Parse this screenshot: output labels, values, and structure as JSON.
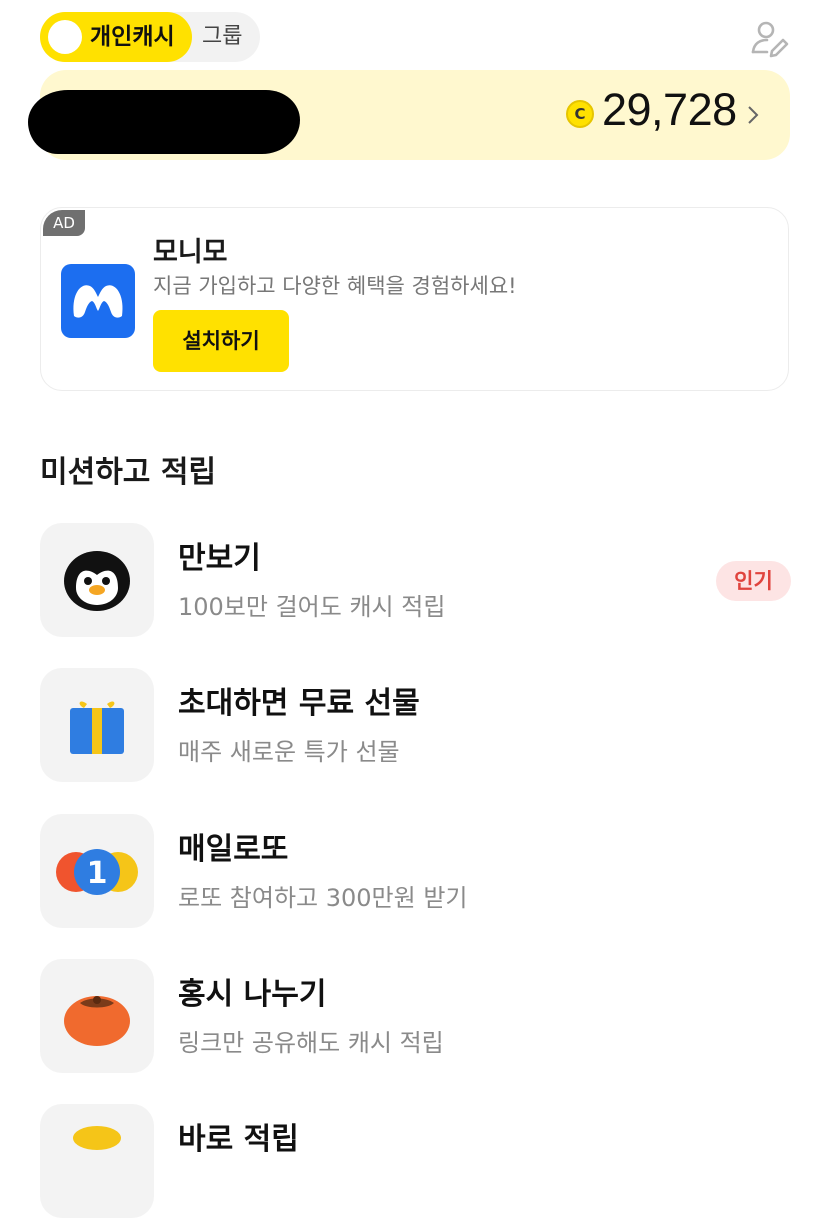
{
  "header": {
    "tab_personal": "개인캐시",
    "tab_group": "그룹"
  },
  "balance": {
    "coin_symbol": "C",
    "amount": "29,728"
  },
  "ad": {
    "badge": "AD",
    "title": "모니모",
    "description": "지금 가입하고 다양한 혜택을 경험하세요!",
    "button": "설치하기"
  },
  "missions_section": {
    "title": "미션하고 적립",
    "items": [
      {
        "title": "만보기",
        "subtitle": "100보만 걸어도 캐시 적립",
        "badge": "인기",
        "icon": "penguin-icon"
      },
      {
        "title": "초대하면 무료 선물",
        "subtitle": "매주 새로운 특가 선물",
        "icon": "gift-icon"
      },
      {
        "title": "매일로또",
        "subtitle": "로또 참여하고 300만원 받기",
        "icon": "lotto-ball-icon"
      },
      {
        "title": "홍시 나누기",
        "subtitle": "링크만 공유해도 캐시 적립",
        "icon": "persimmon-icon"
      },
      {
        "title": "바로 적립",
        "icon": "coin-icon"
      }
    ]
  },
  "colors": {
    "accent_yellow": "#ffe100",
    "balance_bg": "#fff8cf",
    "badge_red": "#e0443e"
  }
}
